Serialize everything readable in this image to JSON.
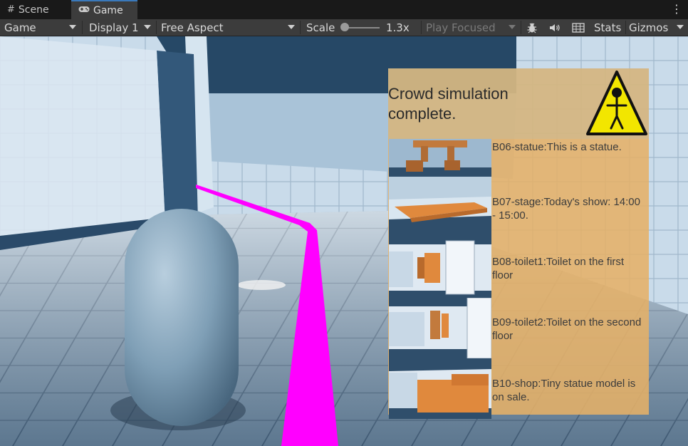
{
  "tabs": [
    {
      "label": "Scene",
      "icon": "grid-icon"
    },
    {
      "label": "Game",
      "icon": "gamepad-icon",
      "active": true
    }
  ],
  "toolbar": {
    "display_mode": "Game",
    "display": "Display 1",
    "aspect": "Free Aspect",
    "scale_label": "Scale",
    "scale_value": "1.3x",
    "scale_fraction": 0.1,
    "play_mode": "Play Focused",
    "stats_label": "Stats",
    "gizmos_label": "Gizmos"
  },
  "overlay": {
    "status": "Crowd simulation complete.",
    "items": [
      {
        "text": "B06-statue:This is a statue."
      },
      {
        "text": "B07-stage:Today's show: 14:00 - 15:00."
      },
      {
        "text": "B08-toilet1:Toilet on the first floor"
      },
      {
        "text": "B09-toilet2:Toilet on the second floor"
      },
      {
        "text": "B10-shop:Tiny statue model is on sale."
      }
    ]
  },
  "colors": {
    "panel": "#e5b068",
    "path": "#ff00ff",
    "warning": "#f2e600"
  }
}
